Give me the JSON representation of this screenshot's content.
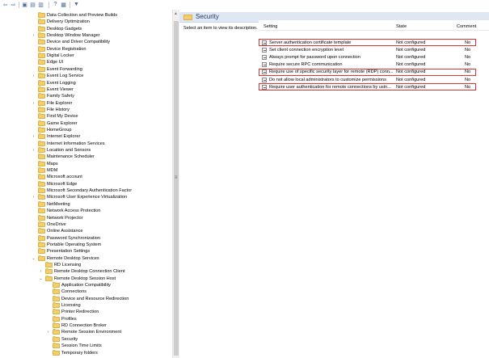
{
  "toolbar": {
    "buttons": [
      {
        "name": "back-icon",
        "glyph": "⇦"
      },
      {
        "name": "forward-icon",
        "glyph": "⇨"
      },
      {
        "name": "up-folder-icon",
        "glyph": "▣"
      },
      {
        "name": "show-hide-tree-icon",
        "glyph": "▤"
      },
      {
        "name": "export-list-icon",
        "glyph": "▥"
      },
      {
        "name": "help-icon",
        "glyph": "?"
      },
      {
        "name": "properties-icon",
        "glyph": "▦"
      },
      {
        "name": "filter-icon",
        "glyph": "▼"
      }
    ]
  },
  "tree": {
    "items": [
      {
        "label": "Data Collection and Preview Builds",
        "depth": 0,
        "expander": ""
      },
      {
        "label": "Delivery Optimization",
        "depth": 0,
        "expander": ""
      },
      {
        "label": "Desktop Gadgets",
        "depth": 0,
        "expander": ""
      },
      {
        "label": "Desktop Window Manager",
        "depth": 0,
        "expander": "›"
      },
      {
        "label": "Device and Driver Compatibility",
        "depth": 0,
        "expander": ""
      },
      {
        "label": "Device Registration",
        "depth": 0,
        "expander": ""
      },
      {
        "label": "Digital Locker",
        "depth": 0,
        "expander": ""
      },
      {
        "label": "Edge UI",
        "depth": 0,
        "expander": ""
      },
      {
        "label": "Event Forwarding",
        "depth": 0,
        "expander": ""
      },
      {
        "label": "Event Log Service",
        "depth": 0,
        "expander": "›"
      },
      {
        "label": "Event Logging",
        "depth": 0,
        "expander": ""
      },
      {
        "label": "Event Viewer",
        "depth": 0,
        "expander": ""
      },
      {
        "label": "Family Safety",
        "depth": 0,
        "expander": ""
      },
      {
        "label": "File Explorer",
        "depth": 0,
        "expander": "›"
      },
      {
        "label": "File History",
        "depth": 0,
        "expander": ""
      },
      {
        "label": "Find My Device",
        "depth": 0,
        "expander": ""
      },
      {
        "label": "Game Explorer",
        "depth": 0,
        "expander": ""
      },
      {
        "label": "HomeGroup",
        "depth": 0,
        "expander": ""
      },
      {
        "label": "Internet Explorer",
        "depth": 0,
        "expander": "›"
      },
      {
        "label": "Internet Information Services",
        "depth": 0,
        "expander": ""
      },
      {
        "label": "Location and Sensors",
        "depth": 0,
        "expander": "›"
      },
      {
        "label": "Maintenance Scheduler",
        "depth": 0,
        "expander": ""
      },
      {
        "label": "Maps",
        "depth": 0,
        "expander": ""
      },
      {
        "label": "MDM",
        "depth": 0,
        "expander": ""
      },
      {
        "label": "Microsoft account",
        "depth": 0,
        "expander": ""
      },
      {
        "label": "Microsoft Edge",
        "depth": 0,
        "expander": ""
      },
      {
        "label": "Microsoft Secondary Authentication Factor",
        "depth": 0,
        "expander": ""
      },
      {
        "label": "Microsoft User Experience Virtualization",
        "depth": 0,
        "expander": "›"
      },
      {
        "label": "NetMeeting",
        "depth": 0,
        "expander": ""
      },
      {
        "label": "Network Access Protection",
        "depth": 0,
        "expander": ""
      },
      {
        "label": "Network Projector",
        "depth": 0,
        "expander": ""
      },
      {
        "label": "OneDrive",
        "depth": 0,
        "expander": ""
      },
      {
        "label": "Online Assistance",
        "depth": 0,
        "expander": ""
      },
      {
        "label": "Password Synchronization",
        "depth": 0,
        "expander": ""
      },
      {
        "label": "Portable Operating System",
        "depth": 0,
        "expander": ""
      },
      {
        "label": "Presentation Settings",
        "depth": 0,
        "expander": ""
      },
      {
        "label": "Remote Desktop Services",
        "depth": 0,
        "expander": "⌄"
      },
      {
        "label": "RD Licensing",
        "depth": 1,
        "expander": ""
      },
      {
        "label": "Remote Desktop Connection Client",
        "depth": 1,
        "expander": "›"
      },
      {
        "label": "Remote Desktop Session Host",
        "depth": 1,
        "expander": "⌄"
      },
      {
        "label": "Application Compatibility",
        "depth": 2,
        "expander": ""
      },
      {
        "label": "Connections",
        "depth": 2,
        "expander": ""
      },
      {
        "label": "Device and Resource Redirection",
        "depth": 2,
        "expander": ""
      },
      {
        "label": "Licensing",
        "depth": 2,
        "expander": ""
      },
      {
        "label": "Printer Redirection",
        "depth": 2,
        "expander": ""
      },
      {
        "label": "Profiles",
        "depth": 2,
        "expander": ""
      },
      {
        "label": "RD Connection Broker",
        "depth": 2,
        "expander": ""
      },
      {
        "label": "Remote Session Environment",
        "depth": 2,
        "expander": "›"
      },
      {
        "label": "Security",
        "depth": 2,
        "expander": ""
      },
      {
        "label": "Session Time Limits",
        "depth": 2,
        "expander": ""
      },
      {
        "label": "Temporary folders",
        "depth": 2,
        "expander": ""
      }
    ]
  },
  "header": {
    "title": "Security"
  },
  "description": "Select an item to view its description.",
  "columns": {
    "setting": "Setting",
    "state": "State",
    "comment": "Comment"
  },
  "policies": [
    {
      "name": "Server authentication certificate template",
      "state": "Not configured",
      "comment": "No",
      "highlighted": true
    },
    {
      "name": "Set client connection encryption level",
      "state": "Not configured",
      "comment": "No",
      "highlighted": false
    },
    {
      "name": "Always prompt for password upon connection",
      "state": "Not configured",
      "comment": "No",
      "highlighted": false
    },
    {
      "name": "Require secure RPC communication",
      "state": "Not configured",
      "comment": "No",
      "highlighted": false
    },
    {
      "name": "Require use of specific security layer for remote (RDP) conn...",
      "state": "Not configured",
      "comment": "No",
      "highlighted": true
    },
    {
      "name": "Do not allow local administrators to customize permissions",
      "state": "Not configured",
      "comment": "No",
      "highlighted": false
    },
    {
      "name": "Require user authentication for remote connections by usin...",
      "state": "Not configured",
      "comment": "No",
      "highlighted": true
    }
  ],
  "colors": {
    "highlight": "#e03232",
    "header_bg": "#dfe7f3",
    "folder": "#f2cf6a"
  }
}
